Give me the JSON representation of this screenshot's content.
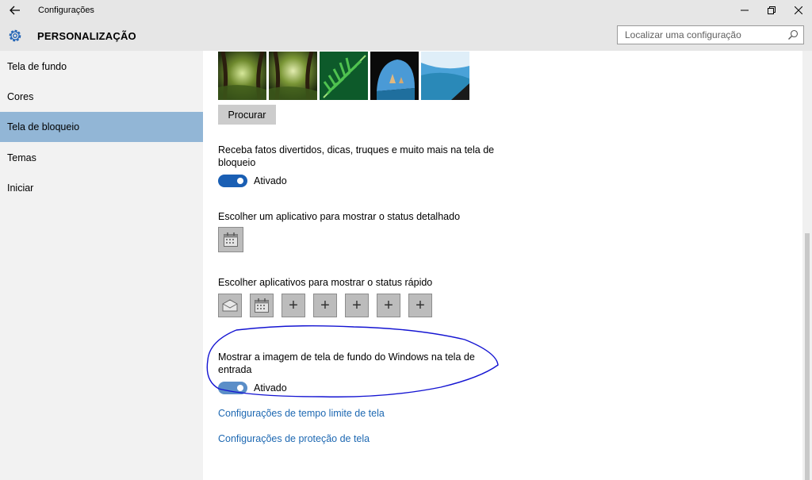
{
  "window": {
    "title": "Configurações",
    "back_icon": "back-arrow-icon",
    "controls": [
      "minimize",
      "restore",
      "close"
    ]
  },
  "header": {
    "title": "PERSONALIZAÇÃO",
    "icon": "gear-icon",
    "search": {
      "placeholder": "Localizar uma configuração",
      "value": ""
    }
  },
  "sidebar": {
    "items": [
      {
        "label": "Tela de fundo",
        "active": false
      },
      {
        "label": "Cores",
        "active": false
      },
      {
        "label": "Tela de bloqueio",
        "active": true
      },
      {
        "label": "Temas",
        "active": false
      },
      {
        "label": "Iniciar",
        "active": false
      }
    ]
  },
  "main": {
    "browse_label": "Procurar",
    "fun_facts": {
      "line1": "Receba fatos divertidos, dicas, truques e muito mais na tela de",
      "line2": "bloqueio",
      "state": "Ativado"
    },
    "detailed_status": {
      "label": "Escolher um aplicativo para mostrar o status detalhado",
      "app_icon": "calendar-icon"
    },
    "quick_status": {
      "label": "Escolher aplicativos para mostrar o status rápido",
      "apps": [
        "mail-icon",
        "calendar-icon",
        "plus-icon",
        "plus-icon",
        "plus-icon",
        "plus-icon",
        "plus-icon"
      ]
    },
    "signin_background": {
      "line1": "Mostrar a imagem de tela de fundo do Windows na tela de",
      "line2": "entrada",
      "state": "Ativado"
    },
    "links": {
      "timeout": "Configurações de tempo limite de tela",
      "screensaver": "Configurações de proteção de tela"
    }
  },
  "colors": {
    "accent": "#1a5fb4",
    "link": "#1d68b2",
    "sidebar_active": "#92b6d6",
    "annotation": "#1414d2"
  }
}
